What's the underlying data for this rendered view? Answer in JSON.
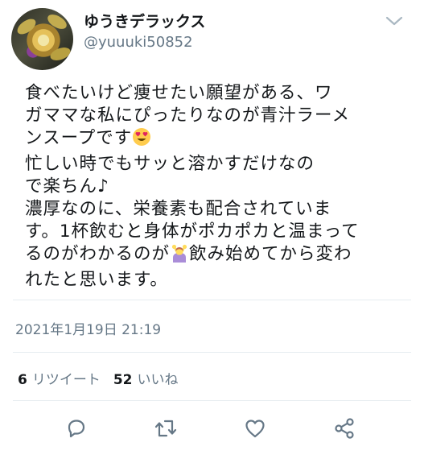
{
  "tweet": {
    "display_name": "ゆうきデラックス",
    "handle": "@yuuuki50852",
    "text_lines": [
      "食べたいけど痩せたい願望がある、ワ",
      "ガママな私にぴったりなのが青汁ラーメ",
      "ンスープです",
      "忙しい時でもサッと溶かすだけなの",
      "で楽ちん♪",
      "濃厚なのに、栄養素も配合されていま",
      "す。1杯飲むと身体がポカポカと温まって",
      "るのがわかるのが",
      "飲み始めてから変わ",
      "れたと思います。"
    ],
    "timestamp": "2021年1月19日 21:19",
    "retweets": {
      "count": "6",
      "label": "リツイート"
    },
    "likes": {
      "count": "52",
      "label": "いいね"
    },
    "icons": [
      "chevron-down-icon",
      "reply-icon",
      "retweet-icon",
      "like-icon",
      "share-icon"
    ],
    "colors": {
      "text": "#14171a",
      "secondary": "#657786",
      "divider": "#e6ecf0"
    }
  }
}
